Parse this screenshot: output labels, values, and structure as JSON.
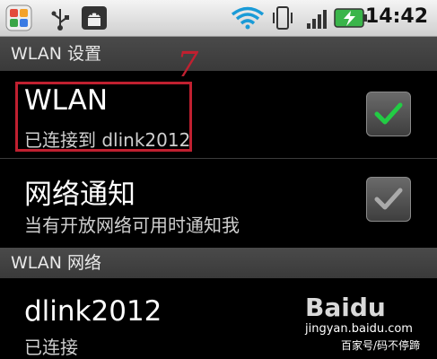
{
  "status_bar": {
    "time": "14:42",
    "icons": [
      "app-grid-icon",
      "usb-icon",
      "android-debug-icon",
      "wifi-icon",
      "vibrate-icon",
      "signal-icon",
      "battery-charging-icon"
    ]
  },
  "header": {
    "title": "WLAN 设置"
  },
  "annotation": {
    "step_number": "7"
  },
  "wlan_row": {
    "title": "WLAN",
    "subtitle": "已连接到 dlink2012",
    "checked": true,
    "accent": "#22cc44"
  },
  "network_notify_row": {
    "title": "网络通知",
    "subtitle": "当有开放网络可用时通知我",
    "checked": true
  },
  "networks_section": {
    "title": "WLAN 网络"
  },
  "network_item": {
    "name": "dlink2012",
    "status": "已连接"
  },
  "watermark": {
    "logo": "Baidu",
    "url": "jingyan.baidu.com",
    "note": "百家号/码不停蹄"
  },
  "colors": {
    "annotation_red": "#c02030",
    "highlight_red": "#c02030"
  }
}
